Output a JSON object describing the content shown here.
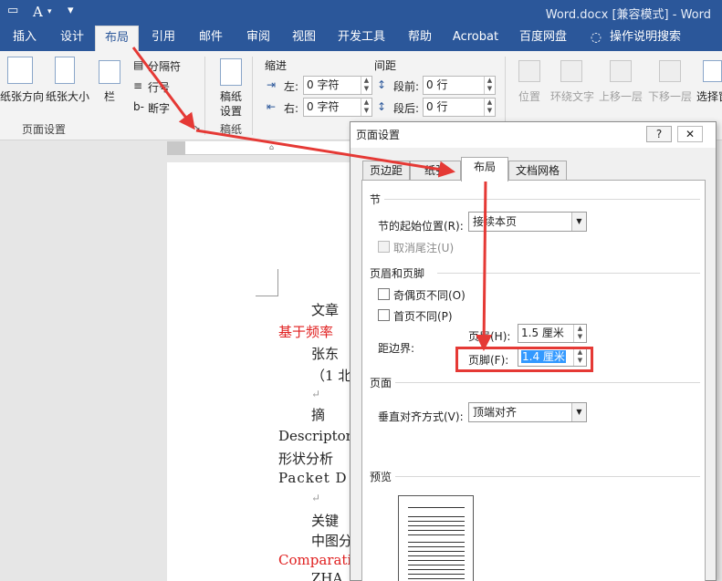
{
  "window": {
    "title": "Word.docx [兼容模式] - Word",
    "font_button": "A",
    "qa_overflow": "▾"
  },
  "ribbon_tabs": [
    {
      "label": "插入"
    },
    {
      "label": "设计"
    },
    {
      "label": "布局",
      "active": true
    },
    {
      "label": "引用"
    },
    {
      "label": "邮件"
    },
    {
      "label": "审阅"
    },
    {
      "label": "视图"
    },
    {
      "label": "开发工具"
    },
    {
      "label": "帮助"
    },
    {
      "label": "Acrobat"
    },
    {
      "label": "百度网盘"
    },
    {
      "label": "操作说明搜索",
      "icon": "lightbulb-icon"
    }
  ],
  "ribbon": {
    "page_setup": {
      "orientation": "纸张方向",
      "size": "纸张大小",
      "columns": "栏",
      "breaks": "分隔符",
      "line_numbers": "行号",
      "hyphenation": "断字",
      "group_label": "页面设置"
    },
    "manuscript": {
      "button": "稿纸设置",
      "line1": "稿纸",
      "line2": "设置",
      "group_label": "稿纸"
    },
    "indent": {
      "label": "缩进",
      "left_label": "左:",
      "left_value": "0 字符",
      "right_label": "右:",
      "right_value": "0 字符"
    },
    "spacing": {
      "label": "间距",
      "before_label": "段前:",
      "before_value": "0 行",
      "after_label": "段后:",
      "after_value": "0 行"
    },
    "arrange": {
      "position": "位置",
      "wrap": "环绕文字",
      "bring_forward": "上移一层",
      "send_backward": "下移一层",
      "selection": "选择窗"
    }
  },
  "document": {
    "lines": [
      {
        "text": "文章",
        "color": "#222222"
      },
      {
        "text": "基于频率",
        "color": "#e02020"
      },
      {
        "text": "张东",
        "color": "#222222"
      },
      {
        "text": "（1 北",
        "color": "#222222"
      },
      {
        "text": "↵",
        "color": "#999999"
      },
      {
        "text": "摘",
        "color": "#222222"
      },
      {
        "text": "Descriptor",
        "color": "#222222"
      },
      {
        "text": "形状分析",
        "color": "#222222"
      },
      {
        "text": "Packet D",
        "color": "#222222"
      },
      {
        "text": "↵",
        "color": "#999999"
      },
      {
        "text": "关键",
        "color": "#222222"
      },
      {
        "text": "中图分",
        "color": "#222222"
      },
      {
        "text": "Comparati",
        "color": "#e02020"
      },
      {
        "text": "ZHA",
        "color": "#222222"
      }
    ]
  },
  "dialog": {
    "title": "页面设置",
    "help": "?",
    "close": "✕",
    "tabs": [
      {
        "label": "页边距"
      },
      {
        "label": "纸张"
      },
      {
        "label": "布局",
        "active": true
      },
      {
        "label": "文档网格"
      }
    ],
    "section": {
      "header": "节",
      "start_label": "节的起始位置(R):",
      "start_value": "接续本页",
      "suppress_endnotes": "取消尾注(U)"
    },
    "headers_footers": {
      "header": "页眉和页脚",
      "odd_even": "奇偶页不同(O)",
      "first_page": "首页不同(P)",
      "from_edge": "距边界:",
      "header_label": "页眉(H):",
      "header_value": "1.5 厘米",
      "footer_label": "页脚(F):",
      "footer_value": "1.4 厘米"
    },
    "page": {
      "header": "页面",
      "valign_label": "垂直对齐方式(V):",
      "valign_value": "顶端对齐"
    },
    "preview": {
      "header": "预览"
    }
  },
  "colors": {
    "title_blue": "#2b579a",
    "annotation_red": "#e53935",
    "selection_blue": "#3399ff"
  }
}
